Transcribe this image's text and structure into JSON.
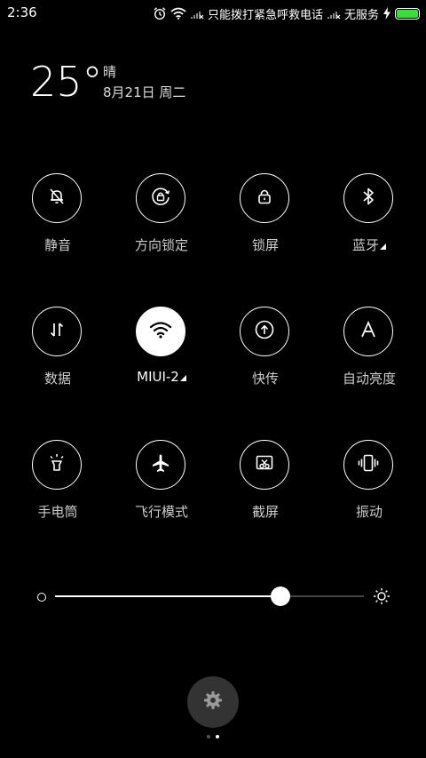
{
  "status_bar": {
    "time": "2:36",
    "carrier_emergency": "只能拨打紧急呼救电话",
    "carrier_no_service": "无服务",
    "icons": [
      "alarm-icon",
      "wifi-icon",
      "no-signal-icon",
      "no-signal-icon",
      "charging-icon",
      "battery-icon"
    ],
    "battery_color": "#3ddc3d",
    "battery_level": 1.0
  },
  "weather": {
    "temperature": "25°",
    "condition": "晴",
    "date": "8月21日 周二"
  },
  "toggles": [
    {
      "label": "静音",
      "icon": "bell-off-icon",
      "active": false
    },
    {
      "label": "方向锁定",
      "icon": "rotation-lock-icon",
      "active": false
    },
    {
      "label": "锁屏",
      "icon": "lock-icon",
      "active": false
    },
    {
      "label": "蓝牙",
      "icon": "bluetooth-icon",
      "active": false
    },
    {
      "label": "数据",
      "icon": "mobile-data-icon",
      "active": false
    },
    {
      "label": "MIUI-2",
      "icon": "wifi-icon",
      "active": true
    },
    {
      "label": "快传",
      "icon": "fast-transfer-icon",
      "active": false
    },
    {
      "label": "自动亮度",
      "icon": "auto-brightness-icon",
      "active": false
    },
    {
      "label": "手电筒",
      "icon": "flashlight-icon",
      "active": false
    },
    {
      "label": "飞行模式",
      "icon": "airplane-icon",
      "active": false
    },
    {
      "label": "截屏",
      "icon": "screenshot-icon",
      "active": false
    },
    {
      "label": "振动",
      "icon": "vibrate-icon",
      "active": false
    }
  ],
  "brightness": {
    "level": 0.73
  },
  "bottom": {
    "settings_icon": "gear-icon",
    "page_count": 2,
    "active_page": 2
  },
  "colors": {
    "background": "#000000",
    "foreground": "#ffffff",
    "settings_button_bg": "#333333"
  }
}
